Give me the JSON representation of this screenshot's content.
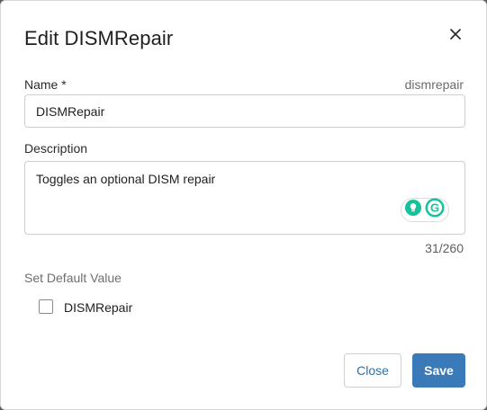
{
  "dialog": {
    "title": "Edit DISMRepair",
    "close_icon": "close-icon"
  },
  "name_field": {
    "label": "Name *",
    "slug": "dismrepair",
    "value": "DISMRepair"
  },
  "description_field": {
    "label": "Description",
    "value": "Toggles an optional DISM repair",
    "counter": "31/260"
  },
  "grammarly": {
    "icons": [
      "lightbulb-icon",
      "grammarly-icon"
    ],
    "logo_letter": "G",
    "colors": {
      "bulb": "#15c39a",
      "logo": "#15c39a"
    }
  },
  "default_value": {
    "section_label": "Set Default Value",
    "checkbox_label": "DISMRepair",
    "checked": false
  },
  "buttons": {
    "close_label": "Close",
    "save_label": "Save"
  },
  "colors": {
    "primary": "#3a7ab8",
    "link": "#2f6fa8"
  }
}
